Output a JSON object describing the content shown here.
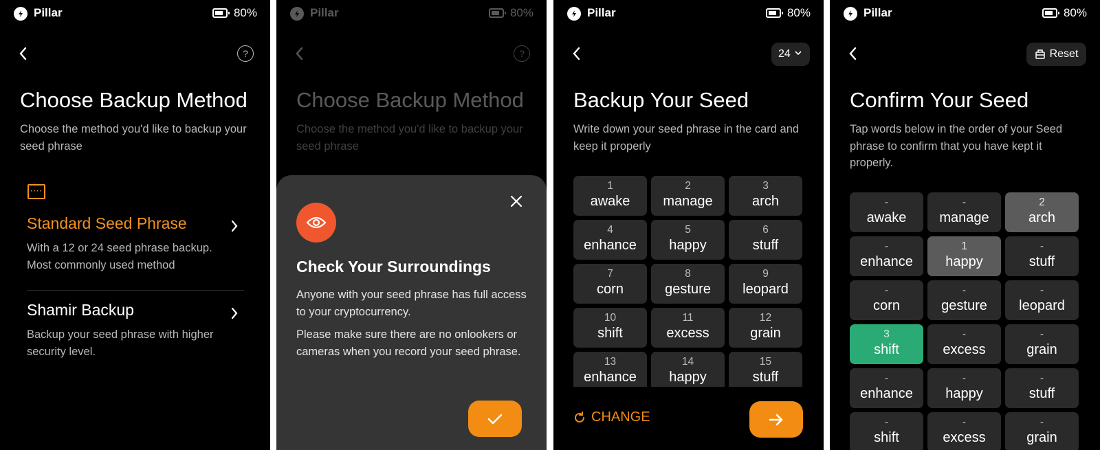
{
  "status": {
    "app_name": "Pillar",
    "battery": "80%"
  },
  "screen1": {
    "title": "Choose Backup Method",
    "subtitle": "Choose the method you'd like to backup your seed phrase",
    "options": [
      {
        "title": "Standard Seed Phrase",
        "desc": "With a 12 or 24 seed phrase backup. Most commonly used method",
        "color": "#f29121"
      },
      {
        "title": "Shamir Backup",
        "desc": "Backup your seed phrase with higher security level.",
        "color": "#ffffff"
      }
    ]
  },
  "screen2": {
    "title": "Choose Backup Method",
    "subtitle": "Choose the method you'd like to backup your seed phrase",
    "sheet": {
      "title": "Check Your Surroundings",
      "p1": "Anyone with your seed phrase has full access to your cryptocurrency.",
      "p2": "Please make sure there are no onlookers or cameras when you record your seed phrase."
    }
  },
  "screen3": {
    "count": "24",
    "title": "Backup Your Seed",
    "subtitle": "Write down your seed phrase in the card and keep it properly",
    "words": [
      {
        "n": "1",
        "w": "awake"
      },
      {
        "n": "2",
        "w": "manage"
      },
      {
        "n": "3",
        "w": "arch"
      },
      {
        "n": "4",
        "w": "enhance"
      },
      {
        "n": "5",
        "w": "happy"
      },
      {
        "n": "6",
        "w": "stuff"
      },
      {
        "n": "7",
        "w": "corn"
      },
      {
        "n": "8",
        "w": "gesture"
      },
      {
        "n": "9",
        "w": "leopard"
      },
      {
        "n": "10",
        "w": "shift"
      },
      {
        "n": "11",
        "w": "excess"
      },
      {
        "n": "12",
        "w": "grain"
      },
      {
        "n": "13",
        "w": "enhance"
      },
      {
        "n": "14",
        "w": "happy"
      },
      {
        "n": "15",
        "w": "stuff"
      }
    ],
    "change_label": "CHANGE"
  },
  "screen4": {
    "reset_label": "Reset",
    "title": "Confirm Your Seed",
    "subtitle": "Tap words below in the order of your Seed phrase to confirm that you have kept it properly.",
    "words": [
      {
        "n": "-",
        "w": "awake",
        "state": ""
      },
      {
        "n": "-",
        "w": "manage",
        "state": ""
      },
      {
        "n": "2",
        "w": "arch",
        "state": "sel-gray"
      },
      {
        "n": "-",
        "w": "enhance",
        "state": ""
      },
      {
        "n": "1",
        "w": "happy",
        "state": "sel-gray"
      },
      {
        "n": "-",
        "w": "stuff",
        "state": ""
      },
      {
        "n": "-",
        "w": "corn",
        "state": ""
      },
      {
        "n": "-",
        "w": "gesture",
        "state": ""
      },
      {
        "n": "-",
        "w": "leopard",
        "state": ""
      },
      {
        "n": "3",
        "w": "shift",
        "state": "sel-green"
      },
      {
        "n": "-",
        "w": "excess",
        "state": ""
      },
      {
        "n": "-",
        "w": "grain",
        "state": ""
      },
      {
        "n": "-",
        "w": "enhance",
        "state": ""
      },
      {
        "n": "-",
        "w": "happy",
        "state": ""
      },
      {
        "n": "-",
        "w": "stuff",
        "state": ""
      },
      {
        "n": "-",
        "w": "shift",
        "state": ""
      },
      {
        "n": "-",
        "w": "excess",
        "state": ""
      },
      {
        "n": "-",
        "w": "grain",
        "state": ""
      }
    ]
  }
}
